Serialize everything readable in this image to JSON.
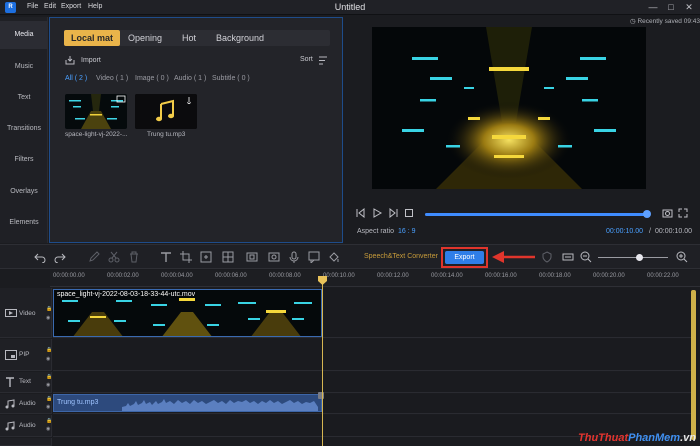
{
  "app": {
    "title": "Untitled",
    "logo": "R"
  },
  "menu": [
    "File",
    "Edit",
    "Export",
    "Help"
  ],
  "sidebar": [
    "Media",
    "Music",
    "Text",
    "Transitions",
    "Filters",
    "Overlays",
    "Elements"
  ],
  "media": {
    "tabs": [
      "Local mat",
      "Opening",
      "Hot",
      "Background"
    ],
    "import_label": "Import",
    "sort_label": "Sort",
    "filters": [
      "All ( 2 )",
      "Video ( 1 )",
      "Image ( 0 )",
      "Audio ( 1 )",
      "Subtitle ( 0 )"
    ],
    "items": [
      {
        "label": "space-light-vj-2022-...",
        "type": "video"
      },
      {
        "label": "Trung tu.mp3",
        "type": "audio"
      }
    ]
  },
  "preview": {
    "saved_text": "Recently saved 09:43",
    "aspect_label": "Aspect ratio",
    "aspect_value": "16 : 9",
    "time_current": "00:00:10.00",
    "time_separator": "/",
    "time_total": "00:00:10.00",
    "progress": 1.0
  },
  "toolbar": {
    "speech_label": "Speech&Text Converter",
    "export_label": "Export"
  },
  "ruler": [
    "00:00:00.00",
    "00:00:02.00",
    "00:00:04.00",
    "00:00:06.00",
    "00:00:08.00",
    "00:00:10.00",
    "00:00:12.00",
    "00:00:14.00",
    "00:00:16.00",
    "00:00:18.00",
    "00:00:20.00",
    "00:00:22.00"
  ],
  "tracks": [
    {
      "label": "Video"
    },
    {
      "label": "PIP"
    },
    {
      "label": "Text"
    },
    {
      "label": "Audio"
    },
    {
      "label": "Audio"
    }
  ],
  "clips": {
    "video": "space_light-vj-2022-08-03-18-33-44-utc.mov",
    "audio": "Trung tu.mp3"
  },
  "watermark": {
    "part1": "ThuThuat",
    "part2": "PhanMem",
    "part3": ".vn"
  },
  "colors": {
    "accent": "#e9b44a",
    "export": "#2f7ee8",
    "highlight": "#e0352c"
  }
}
